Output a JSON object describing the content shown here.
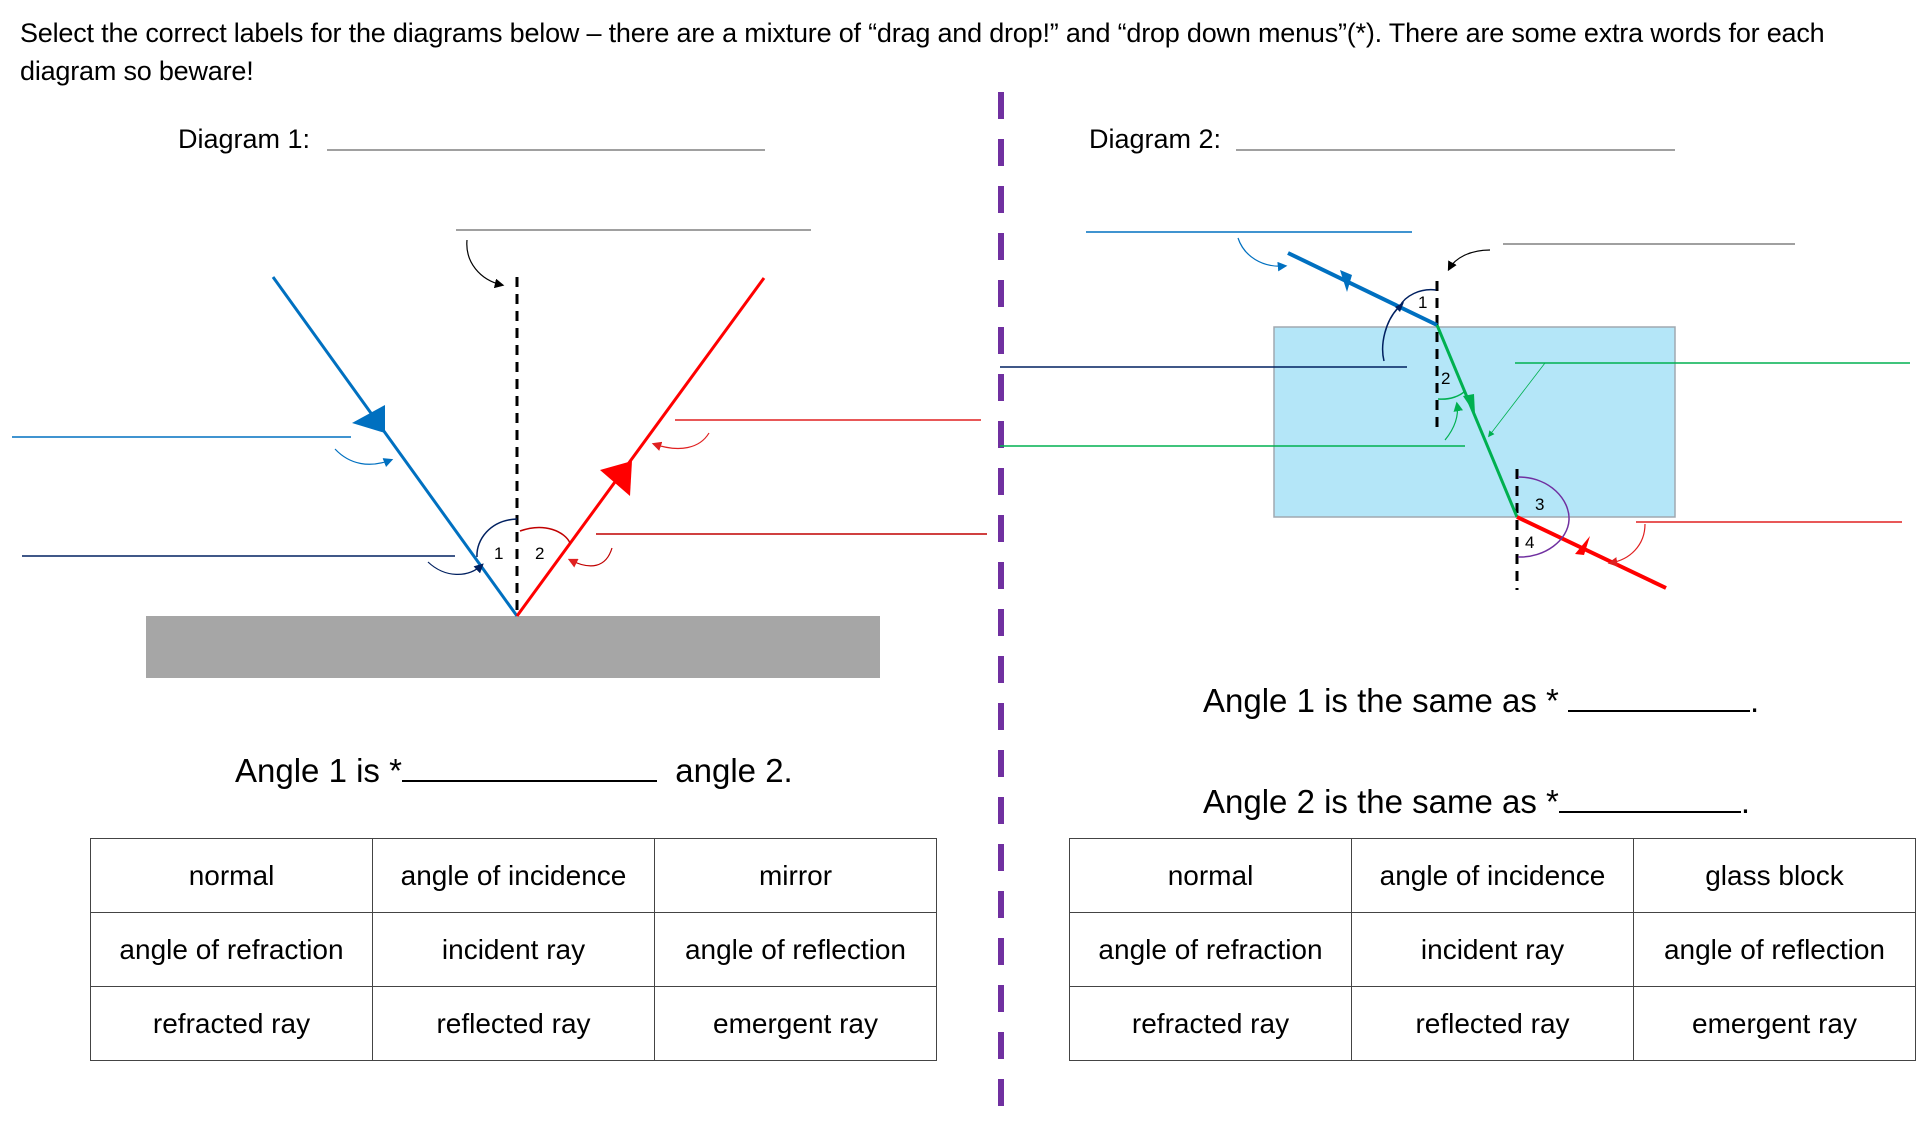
{
  "instructions": "Select the correct labels for the diagrams below – there are a mixture of “drag and drop!” and “drop down menus”(*). There are some extra words for each diagram so beware!",
  "diagram1": {
    "title": "Diagram 1:",
    "angle_labels": [
      "1",
      "2"
    ],
    "sentence": {
      "prefix": "Angle 1 is *",
      "suffix": "angle 2."
    },
    "word_bank": [
      [
        "normal",
        "angle of incidence",
        "mirror"
      ],
      [
        "angle of refraction",
        "incident ray",
        "angle of reflection"
      ],
      [
        "refracted ray",
        "reflected ray",
        "emergent ray"
      ]
    ]
  },
  "diagram2": {
    "title": "Diagram 2:",
    "angle_labels": [
      "1",
      "2",
      "3",
      "4"
    ],
    "sentences": [
      {
        "prefix": "Angle 1 is the same as * ",
        "suffix": "."
      },
      {
        "prefix": "Angle 2 is the same as *",
        "suffix": "."
      }
    ],
    "word_bank": [
      [
        "normal",
        "angle of incidence",
        "glass block"
      ],
      [
        "angle of refraction",
        "incident ray",
        "angle of reflection"
      ],
      [
        "refracted ray",
        "reflected ray",
        "emergent ray"
      ]
    ]
  },
  "colors": {
    "incident_ray": "#0070C0",
    "reflected_ray": "#FF0000",
    "refracted_ray": "#00B050",
    "angle_arc": "#002060",
    "angle_arc_exit": "#7030A0",
    "divider": "#7030A0",
    "mirror": "#A6A6A6",
    "glass_block": "#B4E6F8",
    "label_line_grey": "#808080"
  }
}
